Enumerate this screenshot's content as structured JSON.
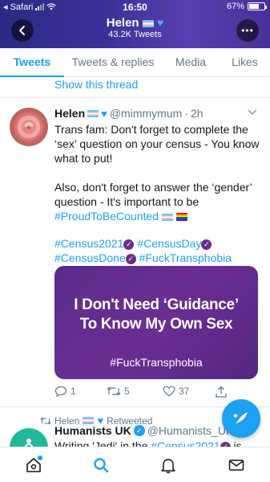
{
  "status_bar": {
    "carrier": "◂ Safari",
    "time": "16:50",
    "battery_text": "67%",
    "battery_level": 0.67
  },
  "header": {
    "name": "Helen",
    "tweet_count": "43.2K Tweets"
  },
  "tabs": [
    {
      "label": "Tweets",
      "active": true
    },
    {
      "label": "Tweets & replies",
      "active": false
    },
    {
      "label": "Media",
      "active": false
    },
    {
      "label": "Likes",
      "active": false
    }
  ],
  "show_thread": "Show this thread",
  "tweet": {
    "name": "Helen",
    "handle": "@mimmymum",
    "separator": "·",
    "time": "2h",
    "line1": "Trans fam: Don't forget to complete the ‘sex’ question on your census - You know what to put!",
    "line2": "Also, don't forget to answer the ‘gender’ question - It's important to be",
    "hashtag_proud": "#ProudToBeCounted",
    "hashtag_census2021": "#Census2021",
    "hashtag_censusday": "#CensusDay",
    "hashtag_censusdone": "#CensusDone",
    "hashtag_fucktransphobia": "#FuckTransphobia",
    "media": {
      "line1": "I Don't Need ‘Guidance’",
      "line2": "To Know My Own Sex",
      "tag": "#FuckTransphobia"
    },
    "actions": {
      "replies": "1",
      "retweets": "5",
      "likes": "37"
    }
  },
  "retweet": {
    "retweeter": "Helen",
    "retweeted_label": "Retweeted",
    "name": "Humanists UK",
    "handle": "@Humanists_UK",
    "text_start": "Writing 'Jedi' in the ",
    "text_hashtag": "#Census2021",
    "text_end": " is"
  },
  "colors": {
    "accent": "#1da1f2",
    "header_gradient_start": "#2a2a86",
    "header_gradient_end": "#5a3fb0",
    "media_bg": "#5b2c8a"
  },
  "icons": {
    "home": "home-icon",
    "search": "search-icon",
    "notifications": "bell-icon",
    "messages": "mail-icon",
    "compose": "compose-icon"
  }
}
